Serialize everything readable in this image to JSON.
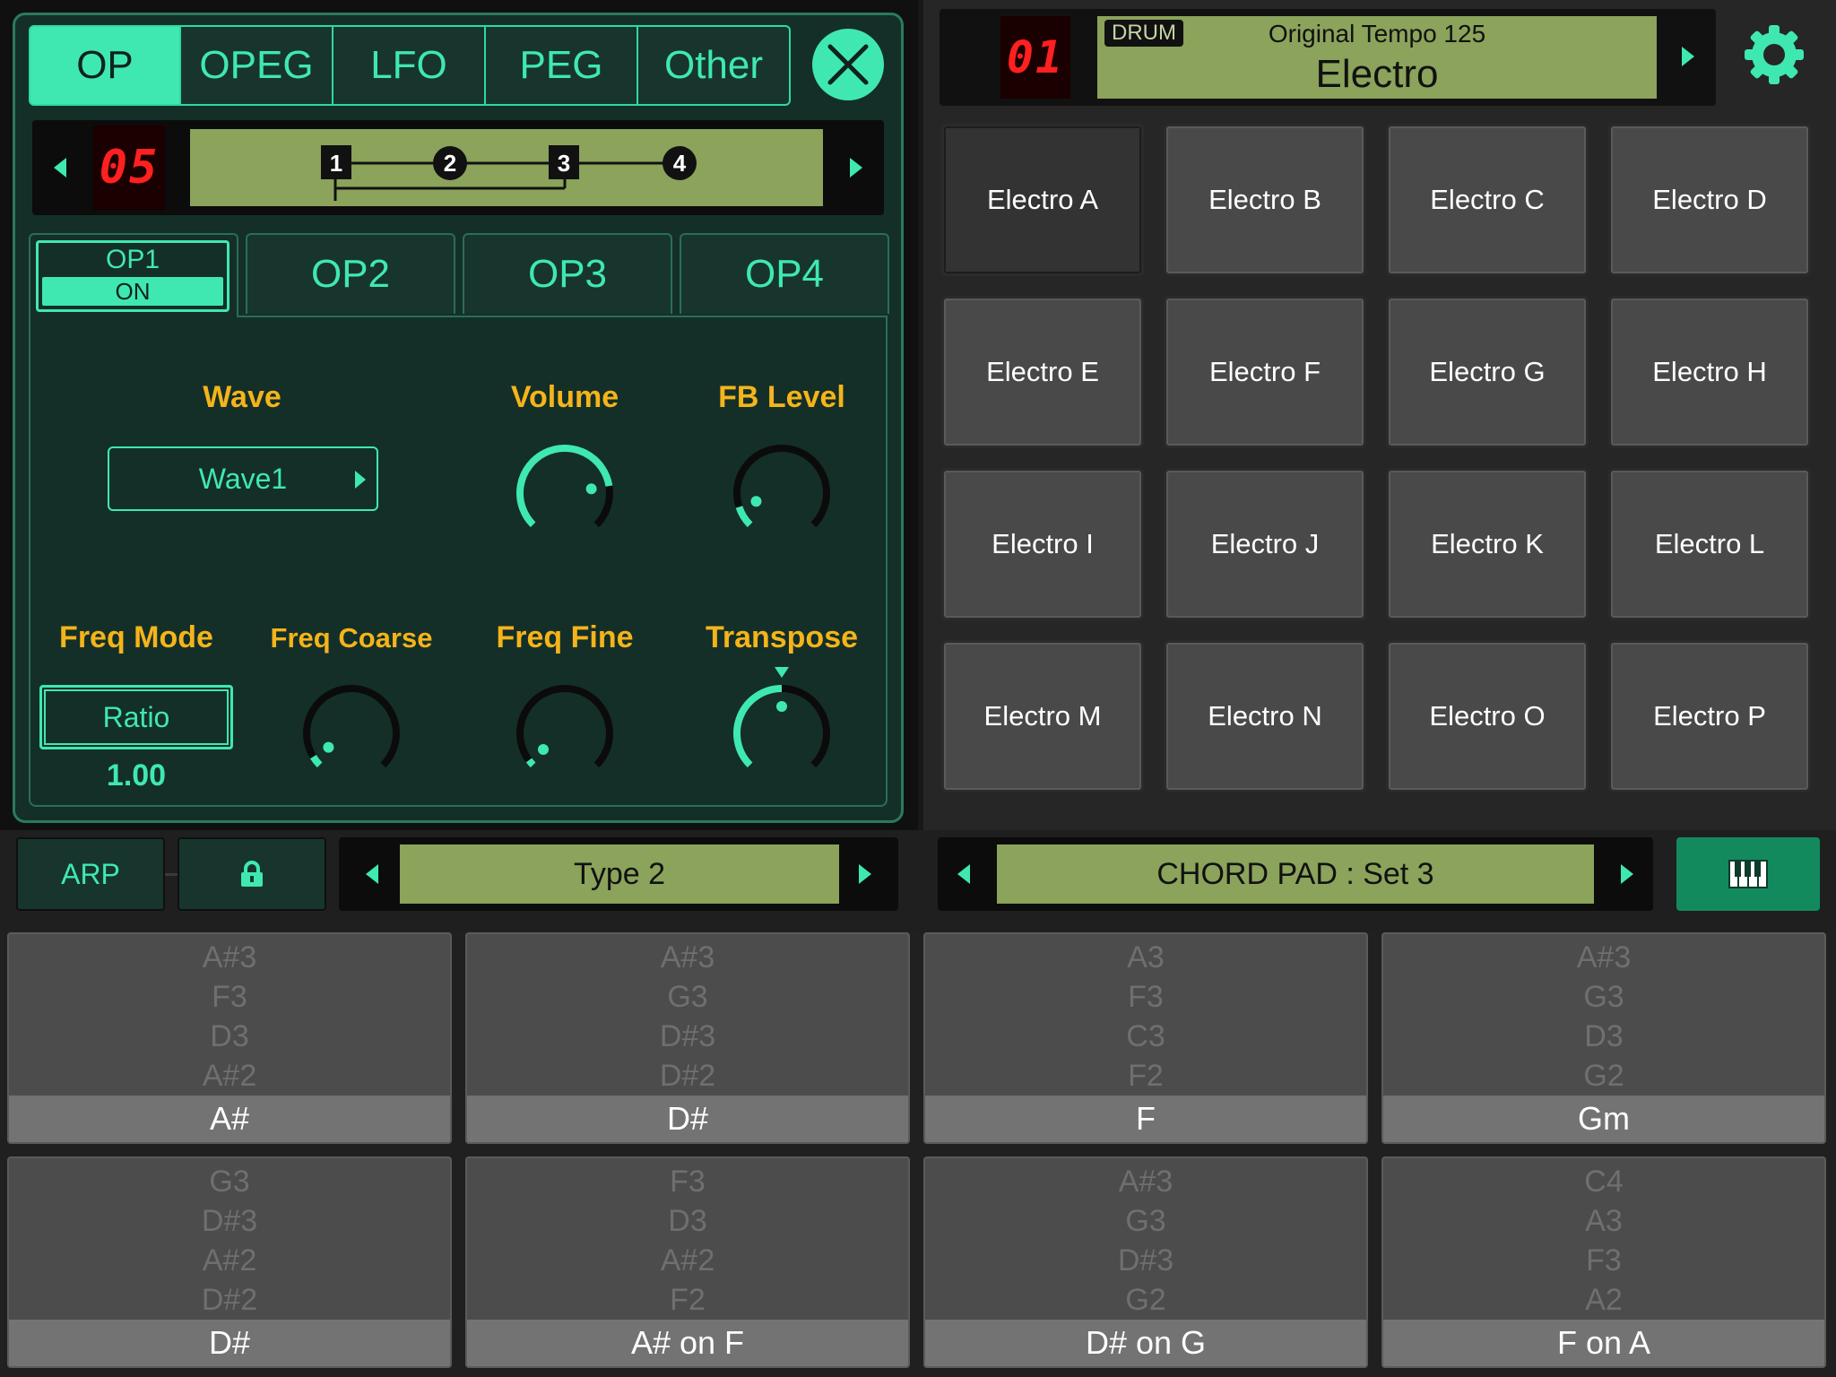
{
  "synth": {
    "tabs": [
      "OP",
      "OPEG",
      "LFO",
      "PEG",
      "Other"
    ],
    "active_tab": "OP",
    "algorithm_number": "05",
    "algorithm_nodes": [
      "1",
      "2",
      "3",
      "4"
    ],
    "op_tabs": {
      "op1": "OP1",
      "op1_state": "ON",
      "op2": "OP2",
      "op3": "OP3",
      "op4": "OP4"
    },
    "params": {
      "wave_label": "Wave",
      "wave_value": "Wave1",
      "volume_label": "Volume",
      "volume_level": 0.8,
      "fb_label": "FB Level",
      "fb_level": 0.1,
      "freq_mode_label": "Freq Mode",
      "freq_mode_value": "Ratio",
      "freq_mode_number": "1.00",
      "freq_coarse_label": "Freq Coarse",
      "freq_coarse_level": 0.05,
      "freq_fine_label": "Freq Fine",
      "freq_fine_level": 0.0,
      "transpose_label": "Transpose",
      "transpose_level": 0.5
    }
  },
  "drum": {
    "kit_number": "01",
    "badge": "DRUM",
    "tempo_text": "Original Tempo 125",
    "kit_name": "Electro",
    "pads": [
      "Electro A",
      "Electro B",
      "Electro C",
      "Electro D",
      "Electro E",
      "Electro F",
      "Electro G",
      "Electro H",
      "Electro I",
      "Electro J",
      "Electro K",
      "Electro L",
      "Electro M",
      "Electro N",
      "Electro O",
      "Electro P"
    ],
    "selected_pad": 0
  },
  "mid_bar": {
    "arp_label": "ARP",
    "type_label": "Type 2",
    "chord_set_label": "CHORD PAD : Set 3"
  },
  "chords": [
    {
      "notes": [
        "A#3",
        "F3",
        "D3",
        "A#2"
      ],
      "name": "A#"
    },
    {
      "notes": [
        "A#3",
        "G3",
        "D#3",
        "D#2"
      ],
      "name": "D#"
    },
    {
      "notes": [
        "A3",
        "F3",
        "C3",
        "F2"
      ],
      "name": "F"
    },
    {
      "notes": [
        "A#3",
        "G3",
        "D3",
        "G2"
      ],
      "name": "Gm"
    },
    {
      "notes": [
        "G3",
        "D#3",
        "A#2",
        "D#2"
      ],
      "name": "D#"
    },
    {
      "notes": [
        "F3",
        "D3",
        "A#2",
        "F2"
      ],
      "name": "A# on F"
    },
    {
      "notes": [
        "A#3",
        "G3",
        "D#3",
        "G2"
      ],
      "name": "D# on G"
    },
    {
      "notes": [
        "C4",
        "A3",
        "F3",
        "A2"
      ],
      "name": "F on A"
    }
  ],
  "colors": {
    "accent": "#3fe8b1",
    "label": "#f4b41a",
    "lcd": "#8ba35a",
    "led": "#ff2020"
  },
  "icons": {
    "close": "close-icon",
    "settings": "gear-icon",
    "lock": "lock-icon",
    "keyboard": "keyboard-icon"
  }
}
